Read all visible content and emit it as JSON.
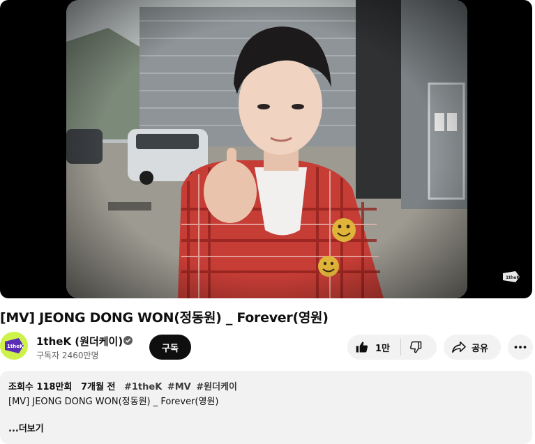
{
  "video": {
    "title": "[MV] JEONG DONG WON(정동원) _ Forever(영원)",
    "watermark_icon": "1thek-logo-icon"
  },
  "channel": {
    "name": "1theK (원더케이)",
    "subscribers": "구독자 2460만명",
    "avatar_icon": "1thek-avatar-icon",
    "verified_icon": "verified-check-icon",
    "avatar_color": "#cdf24a"
  },
  "actions": {
    "subscribe_label": "구독",
    "like_count": "1만",
    "like_icon": "thumbs-up-icon",
    "dislike_icon": "thumbs-down-icon",
    "share_label": "공유",
    "share_icon": "share-icon",
    "more_icon": "more-horizontal-icon"
  },
  "description": {
    "views": "조회수 118만회",
    "age": "7개월 전",
    "hashtags": [
      "#1theK",
      "#MV",
      "#원더케이"
    ],
    "text": "[MV] JEONG DONG WON(정동원) _ Forever(영원)",
    "more_label": "...더보기"
  }
}
